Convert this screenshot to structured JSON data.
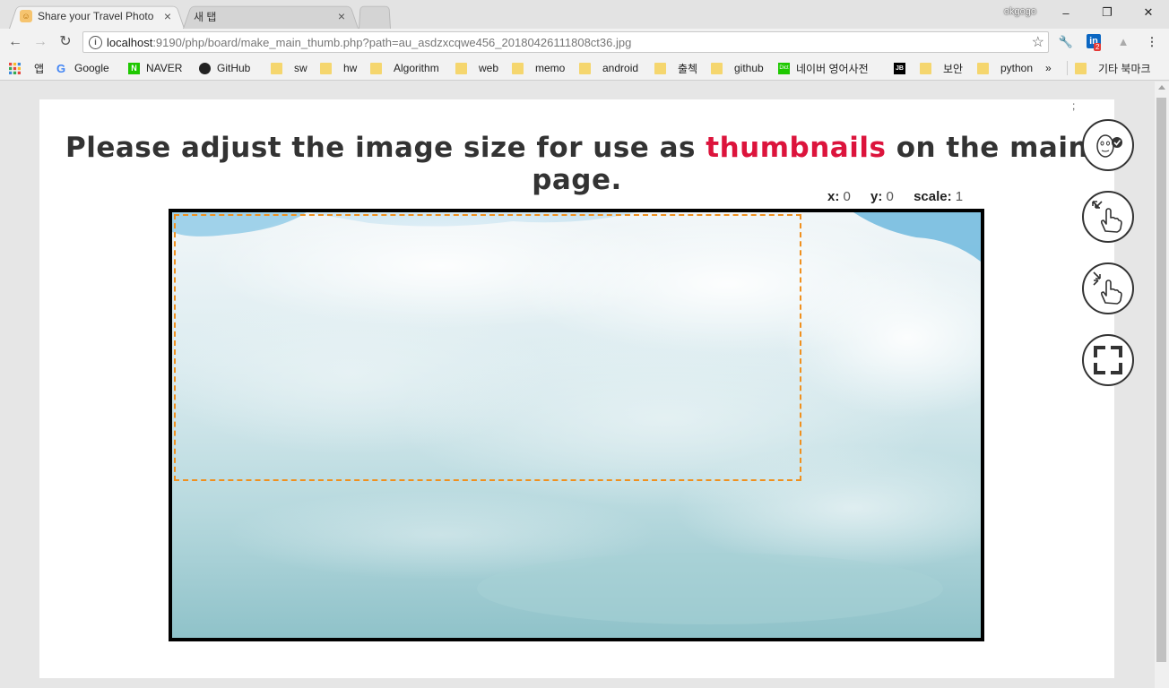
{
  "browser": {
    "tabs": [
      {
        "title": "Share your Travel Photo",
        "close": "×"
      },
      {
        "title": "새 탭",
        "close": "×"
      }
    ],
    "profile": "okgogo",
    "window_controls": {
      "minimize": "–",
      "restore": "❐",
      "close": "✕"
    },
    "nav": {
      "back": "←",
      "forward": "→",
      "reload": "↻"
    },
    "url_host": "localhost",
    "url_rest": ":9190/php/board/make_main_thumb.php?path=au_asdzxcqwe456_20180426111808ct36.jpg",
    "extensions": {
      "linkedin_badge": "2"
    }
  },
  "bookmarks": {
    "items": [
      {
        "label": "앱",
        "icon": "apps-grid-icon"
      },
      {
        "label": "Google",
        "icon": "google-icon"
      },
      {
        "label": "NAVER",
        "icon": "naver-icon"
      },
      {
        "label": "GitHub",
        "icon": "github-icon"
      },
      {
        "label": "sw",
        "icon": "folder-icon"
      },
      {
        "label": "hw",
        "icon": "folder-icon"
      },
      {
        "label": "Algorithm",
        "icon": "folder-icon"
      },
      {
        "label": "web",
        "icon": "folder-icon"
      },
      {
        "label": "memo",
        "icon": "folder-icon"
      },
      {
        "label": "android",
        "icon": "folder-icon"
      },
      {
        "label": "출첵",
        "icon": "folder-icon"
      },
      {
        "label": "github",
        "icon": "folder-icon"
      },
      {
        "label": "네이버 영어사전",
        "icon": "dict-icon"
      },
      {
        "label": "",
        "icon": "jb-icon"
      },
      {
        "label": "보안",
        "icon": "folder-icon"
      },
      {
        "label": "python",
        "icon": "folder-icon"
      }
    ],
    "overflow": "»",
    "other": "기타 북마크"
  },
  "page": {
    "heading_before": "Please adjust the image size for use as ",
    "heading_accent": "thumbnails",
    "heading_after": " on the main page.",
    "x_label": "x:",
    "x_value": "0",
    "y_label": "y:",
    "y_value": "0",
    "scale_label": "scale:",
    "scale_value": "1",
    "accent_color": "#dc143c",
    "crop_color": "#f0901e"
  },
  "side_buttons": [
    {
      "name": "confirm-face-icon"
    },
    {
      "name": "zoom-in-gesture-icon"
    },
    {
      "name": "zoom-out-gesture-icon"
    },
    {
      "name": "fullscreen-icon"
    }
  ]
}
